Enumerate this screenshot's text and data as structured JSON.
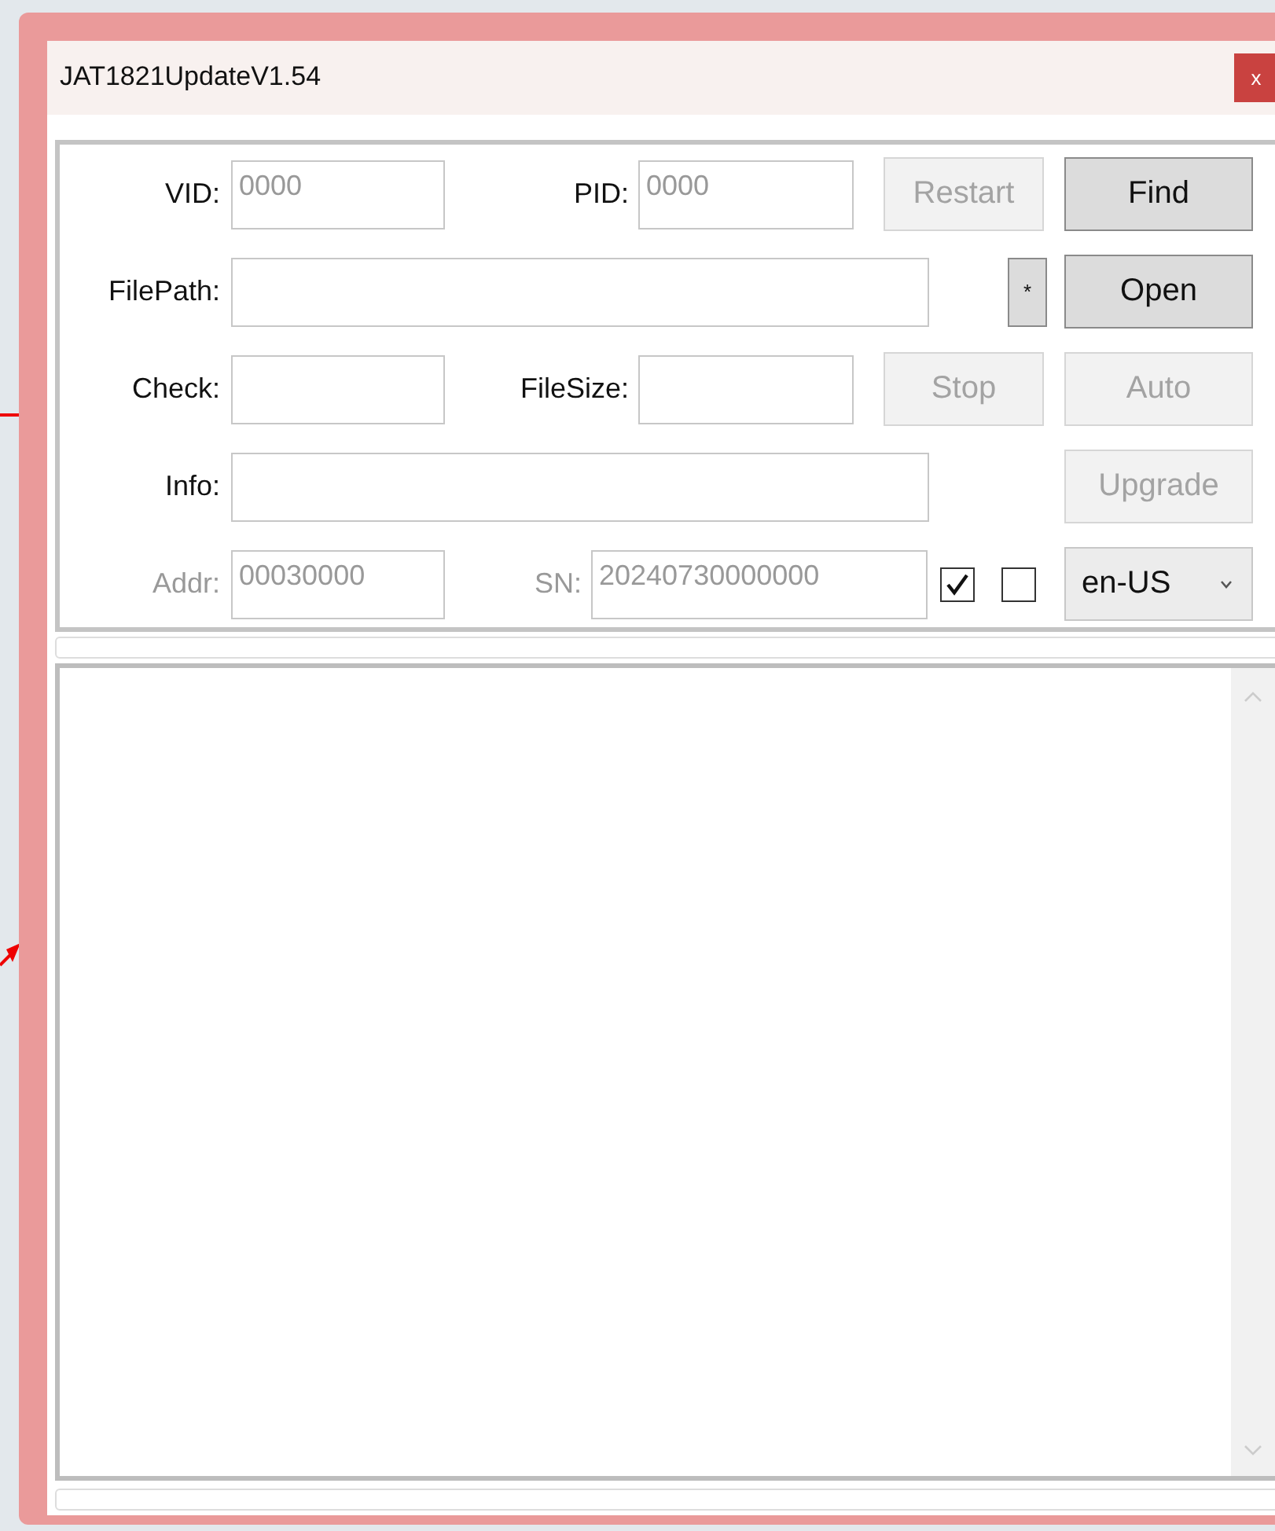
{
  "window": {
    "title": "JAT1821UpdateV1.54",
    "close_button": "x"
  },
  "rows": [
    [
      {
        "kind": "label",
        "text": "VID:",
        "disabled": false
      },
      {
        "kind": "field",
        "value": "0000",
        "disabled": true
      },
      {
        "kind": "label",
        "text": "PID:",
        "disabled": false
      },
      {
        "kind": "field",
        "value": "0000",
        "disabled": true
      },
      {
        "kind": "button",
        "text": "Restart",
        "disabled": true
      },
      {
        "kind": "button",
        "text": "Find",
        "disabled": false
      }
    ],
    [
      {
        "kind": "label",
        "text": "FilePath:",
        "disabled": false
      },
      {
        "kind": "field"
      },
      {
        "kind": "button",
        "text": "*",
        "disabled": false
      },
      {
        "kind": "button",
        "text": "Open",
        "disabled": false
      }
    ],
    [
      {
        "kind": "label",
        "text": "Check:",
        "disabled": false
      },
      {
        "kind": "field"
      },
      {
        "kind": "label",
        "text": "FileSize:",
        "disabled": false
      },
      {
        "kind": "field"
      },
      {
        "kind": "button",
        "text": "Stop",
        "disabled": true
      },
      {
        "kind": "button",
        "text": "Auto",
        "disabled": true
      }
    ],
    [
      {
        "kind": "label",
        "text": "Info:",
        "disabled": false
      },
      {
        "kind": "field"
      },
      {
        "kind": "button",
        "text": "Upgrade",
        "disabled": true
      }
    ],
    [
      {
        "kind": "label",
        "text": "Addr:",
        "disabled": true
      },
      {
        "kind": "field",
        "value": "00030000",
        "disabled": true
      },
      {
        "kind": "label",
        "text": "SN:",
        "disabled": true
      },
      {
        "kind": "field",
        "value": "20240730000000",
        "disabled": true
      },
      {
        "kind": "checkbox",
        "checked": true
      },
      {
        "kind": "checkbox",
        "checked": false
      },
      {
        "kind": "select",
        "value": "en-US"
      }
    ]
  ]
}
